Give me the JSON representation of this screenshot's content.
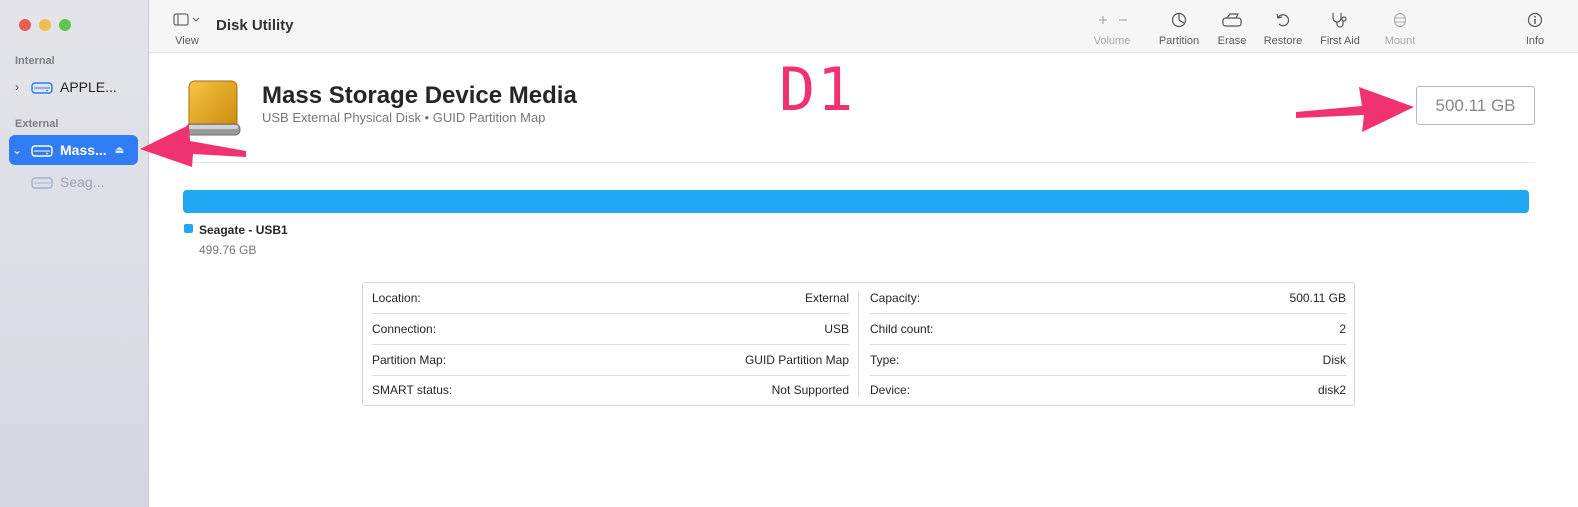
{
  "window": {
    "title": "Disk Utility"
  },
  "sidebar": {
    "sections": [
      {
        "label": "Internal"
      },
      {
        "label": "External"
      }
    ],
    "items": [
      {
        "label": "APPLE...",
        "expanded": false
      },
      {
        "label": "Mass...",
        "expanded": true,
        "selected": true
      },
      {
        "label": "Seag..."
      }
    ]
  },
  "toolbar": {
    "view_label": "View",
    "volume_label": "Volume",
    "partition_label": "Partition",
    "erase_label": "Erase",
    "restore_label": "Restore",
    "firstaid_label": "First Aid",
    "mount_label": "Mount",
    "info_label": "Info"
  },
  "device": {
    "name": "Mass Storage Device Media",
    "subtitle": "USB External Physical Disk • GUID Partition Map",
    "capacity_badge": "500.11 GB",
    "annotation_text": "D1"
  },
  "usage": {
    "partition_name": "Seagate - USB1",
    "partition_size": "499.76 GB",
    "color": "#20a8f2"
  },
  "info": {
    "left": [
      {
        "label": "Location:",
        "value": "External"
      },
      {
        "label": "Connection:",
        "value": "USB"
      },
      {
        "label": "Partition Map:",
        "value": "GUID Partition Map"
      },
      {
        "label": "SMART status:",
        "value": "Not Supported"
      }
    ],
    "right": [
      {
        "label": "Capacity:",
        "value": "500.11 GB"
      },
      {
        "label": "Child count:",
        "value": "2"
      },
      {
        "label": "Type:",
        "value": "Disk"
      },
      {
        "label": "Device:",
        "value": "disk2"
      }
    ]
  },
  "colors": {
    "accent": "#2f7cf5",
    "annotation": "#f0326e"
  }
}
